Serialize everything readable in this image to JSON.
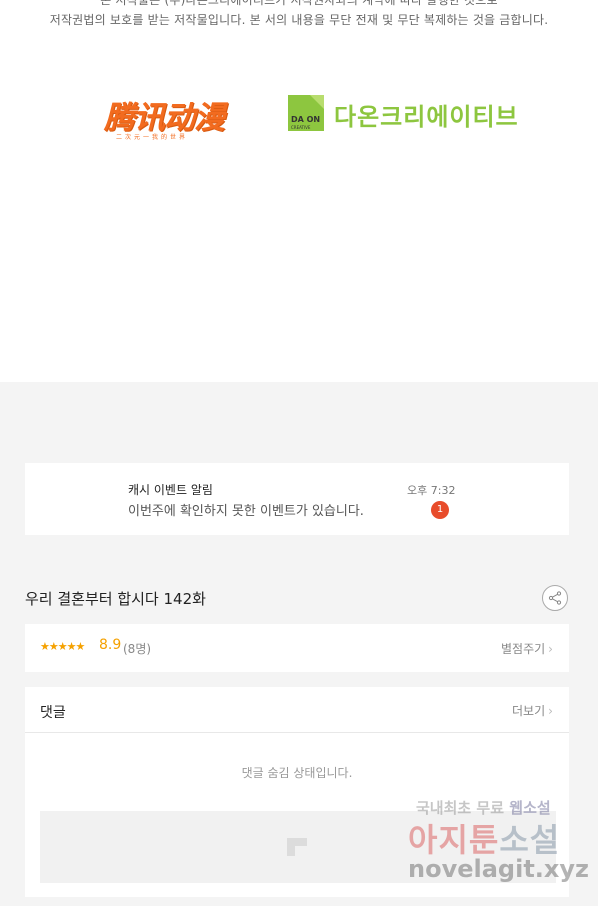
{
  "copyright": {
    "line1": "본 저작물은 (주)다온크리에이티브가 저작권자와의 계약에 따라 발행한 것으로",
    "line2": "저작권법의 보호를 받는 저작물입니다. 본 서의 내용을 무단 전재 및 무단 복제하는 것을 금합니다."
  },
  "logos": {
    "tencent": {
      "name": "腾讯动漫",
      "tagline": "二次元一我的世界",
      "color": "#f26b1f"
    },
    "daon": {
      "mark": "DA ON",
      "mark_sub": "CREATIVE",
      "name": "다온크리에이티브",
      "color": "#8dc63f"
    }
  },
  "notification": {
    "title": "캐시 이벤트 알림",
    "body": "이번주에 확인하지 못한 이벤트가 있습니다.",
    "time": "오후 7:32",
    "badge": "1"
  },
  "episode": {
    "title": "우리 결혼부터 합시다 142화",
    "share_icon": "share-icon"
  },
  "rating": {
    "stars_text": "★★★★★",
    "stars_value": 4.5,
    "score": "8.9",
    "count": "(8명)",
    "rate_label": "별점주기"
  },
  "comments": {
    "title": "댓글",
    "more_label": "더보기",
    "hidden_message": "댓글 숨김 상태입니다."
  },
  "watermark": {
    "line1_a": "국내최초 무료",
    "line1_b": "웹소설",
    "line2_a": "아지툰",
    "line2_b": "소설",
    "line3": "novelagit.xyz"
  }
}
